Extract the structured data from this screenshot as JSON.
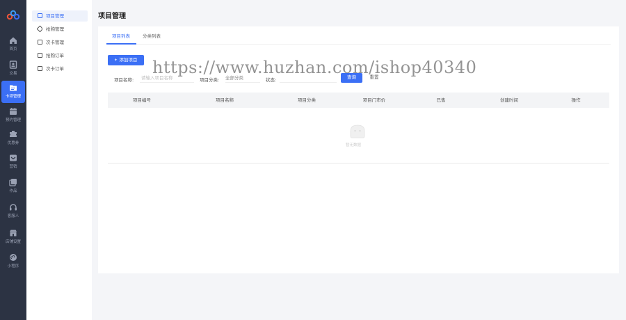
{
  "nav": {
    "items": [
      {
        "label": "首页",
        "icon": "home-icon"
      },
      {
        "label": "交易",
        "icon": "transaction-icon"
      },
      {
        "label": "卡项管理",
        "icon": "card-folder-icon",
        "active": true
      },
      {
        "label": "预约管理",
        "icon": "calendar-icon"
      },
      {
        "label": "优惠券",
        "icon": "coupon-icon"
      },
      {
        "label": "营销",
        "icon": "marketing-icon"
      },
      {
        "label": "作品",
        "icon": "gallery-icon"
      },
      {
        "label": "客服人",
        "icon": "headset-icon"
      },
      {
        "label": "店铺设置",
        "icon": "store-icon"
      },
      {
        "label": "小程序",
        "icon": "mini-program-icon"
      }
    ]
  },
  "submenu": {
    "items": [
      {
        "label": "项目管理",
        "icon": "doc-icon",
        "active": true
      },
      {
        "label": "抢购管理",
        "icon": "tag-icon"
      },
      {
        "label": "次卡管理",
        "icon": "card-icon"
      },
      {
        "label": "抢购订单",
        "icon": "order-icon"
      },
      {
        "label": "次卡订单",
        "icon": "order-icon"
      }
    ]
  },
  "page": {
    "title": "项目管理"
  },
  "tabs": [
    {
      "label": "项目列表",
      "active": true
    },
    {
      "label": "分类列表",
      "active": false
    }
  ],
  "toolbar": {
    "add_label": "添加项目"
  },
  "filters": {
    "name_label": "项目名称:",
    "name_placeholder": "请输入项目名称",
    "category_label": "项目分类:",
    "category_value": "全部分类",
    "status_label": "状态:",
    "query_label": "查询",
    "reset_label": "重置"
  },
  "table": {
    "columns": [
      "项目编号",
      "项目名称",
      "项目分类",
      "项目门市价",
      "已售",
      "创建时间",
      "操作"
    ],
    "empty_text": "暂无数据"
  },
  "watermark": "https://www.huzhan.com/ishop40340",
  "colors": {
    "accent": "#3b6ff5",
    "nav_bg": "#2c3343"
  }
}
